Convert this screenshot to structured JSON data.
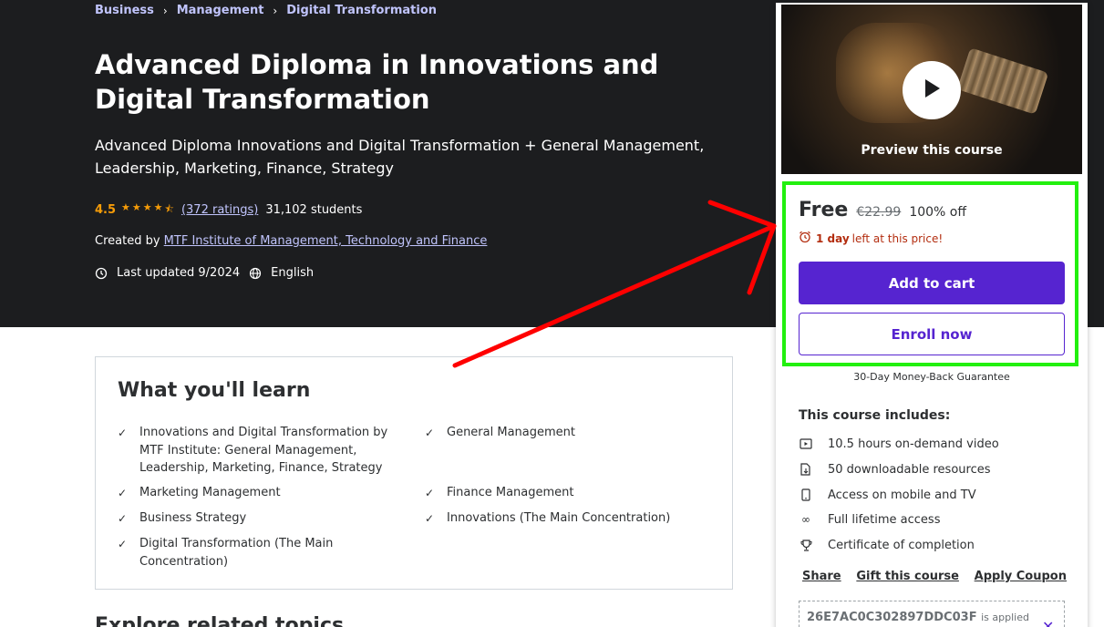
{
  "breadcrumb": {
    "items": [
      "Business",
      "Management",
      "Digital Transformation"
    ],
    "separator": "›"
  },
  "course": {
    "title": "Advanced Diploma in Innovations and Digital Transformation",
    "subtitle": "Advanced Diploma Innovations and Digital Transformation + General Management, Leadership, Marketing, Finance, Strategy",
    "rating": "4.5",
    "rating_stars": 4.5,
    "ratings_count": "(372 ratings)",
    "students": "31,102 students",
    "created_by_label": "Created by",
    "author": "MTF Institute of Management, Technology and Finance",
    "last_updated": "Last updated 9/2024",
    "language": "English"
  },
  "learn": {
    "title": "What you'll learn",
    "items": [
      "Innovations and Digital Transformation by MTF Institute: General Management, Leadership, Marketing, Finance, Strategy",
      "General Management",
      "Marketing Management",
      "Finance Management",
      "Business Strategy",
      "Innovations (The Main Concentration)",
      "Digital Transformation (The Main Concentration)"
    ]
  },
  "next_section_heading": "Explore related topics",
  "sidebar": {
    "preview_label": "Preview this course",
    "price": "Free",
    "original_price": "€22.99",
    "discount": "100% off",
    "timer_bold": "1 day",
    "timer_text": "left at this price!",
    "add_to_cart": "Add to cart",
    "enroll_now": "Enroll now",
    "guarantee": "30-Day Money-Back Guarantee",
    "includes_title": "This course includes:",
    "includes": [
      {
        "icon": "video-icon",
        "text": "10.5 hours on-demand video"
      },
      {
        "icon": "download-file-icon",
        "text": "50 downloadable resources"
      },
      {
        "icon": "mobile-icon",
        "text": "Access on mobile and TV"
      },
      {
        "icon": "infinity-icon",
        "text": "Full lifetime access"
      },
      {
        "icon": "trophy-icon",
        "text": "Certificate of completion"
      }
    ],
    "links": [
      "Share",
      "Gift this course",
      "Apply Coupon"
    ],
    "coupon_code": "26E7AC0C302897DDC03F",
    "coupon_applied": "is applied"
  },
  "colors": {
    "hero_bg": "#1c1d1f",
    "accent_purple": "#5624d0",
    "star_orange": "#f69c08",
    "link_lavender": "#c0c4fc",
    "highlight_green": "#22f00f",
    "arrow_red": "#ff0000",
    "timer_red": "#b32d0f"
  }
}
